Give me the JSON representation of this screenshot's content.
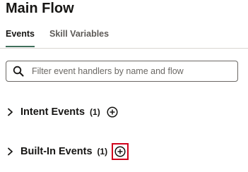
{
  "header": {
    "title": "Main Flow"
  },
  "tabs": [
    {
      "label": "Events",
      "active": true
    },
    {
      "label": "Skill Variables",
      "active": false
    }
  ],
  "search": {
    "placeholder": "Filter event handlers by name and flow",
    "value": ""
  },
  "sections": [
    {
      "label": "Intent Events",
      "count": "(1)",
      "expanded": false
    },
    {
      "label": "Built-In Events",
      "count": "(1)",
      "expanded": false,
      "add_highlighted": true
    }
  ],
  "icons": {
    "search": "search-icon",
    "chevron": "chevron-right-icon",
    "add": "add-circle-icon"
  },
  "colors": {
    "active_tab_underline": "#3f6f5a",
    "highlight_box": "#d0021b"
  }
}
